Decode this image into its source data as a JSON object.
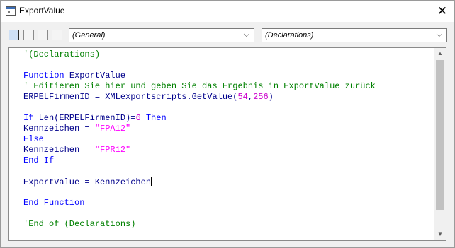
{
  "window": {
    "title": "ExportValue",
    "close_glyph": "✕"
  },
  "toolbar": {
    "view_buttons": [
      "full-module-view",
      "align-left",
      "align-right",
      "align-justify"
    ],
    "object_combo": {
      "value": "(General)"
    },
    "procedure_combo": {
      "value": "(Declarations)"
    },
    "dropdown_glyph": "⌵"
  },
  "editor": {
    "lines": [
      {
        "segments": [
          {
            "text": "'(Declarations)",
            "kind": "comment"
          }
        ]
      },
      {
        "segments": []
      },
      {
        "segments": [
          {
            "text": "Function",
            "kind": "keyword"
          },
          {
            "text": " ",
            "kind": "plain"
          },
          {
            "text": "ExportValue",
            "kind": "ident"
          }
        ]
      },
      {
        "segments": [
          {
            "text": "' Editieren Sie hier und geben Sie das Ergebnis in ExportValue zurück",
            "kind": "comment"
          }
        ]
      },
      {
        "segments": [
          {
            "text": "ERPELFirmenID = XMLexportscripts.GetValue(",
            "kind": "ident"
          },
          {
            "text": "54",
            "kind": "number"
          },
          {
            "text": ",",
            "kind": "ident"
          },
          {
            "text": "256",
            "kind": "number"
          },
          {
            "text": ")",
            "kind": "ident"
          }
        ]
      },
      {
        "segments": []
      },
      {
        "segments": [
          {
            "text": "If",
            "kind": "keyword"
          },
          {
            "text": " ",
            "kind": "plain"
          },
          {
            "text": "Len(ERPELFirmenID)=",
            "kind": "ident"
          },
          {
            "text": "6",
            "kind": "number"
          },
          {
            "text": " ",
            "kind": "plain"
          },
          {
            "text": "Then",
            "kind": "keyword"
          }
        ]
      },
      {
        "segments": [
          {
            "text": "Kennzeichen = ",
            "kind": "ident"
          },
          {
            "text": "\"FPA12\"",
            "kind": "string"
          }
        ]
      },
      {
        "segments": [
          {
            "text": "Else",
            "kind": "keyword"
          }
        ]
      },
      {
        "segments": [
          {
            "text": "Kennzeichen = ",
            "kind": "ident"
          },
          {
            "text": "\"FPR12\"",
            "kind": "string"
          }
        ]
      },
      {
        "segments": [
          {
            "text": "End If",
            "kind": "keyword"
          }
        ]
      },
      {
        "segments": []
      },
      {
        "segments": [
          {
            "text": "ExportValue = Kennzeichen",
            "kind": "ident"
          }
        ],
        "caret": true
      },
      {
        "segments": []
      },
      {
        "segments": [
          {
            "text": "End Function",
            "kind": "keyword"
          }
        ]
      },
      {
        "segments": []
      },
      {
        "segments": [
          {
            "text": "'End of (Declarations)",
            "kind": "comment"
          }
        ]
      }
    ]
  },
  "scrollbar": {
    "up_glyph": "▲",
    "down_glyph": "▼"
  },
  "colors": {
    "comment": "#008000",
    "keyword": "#0000ff",
    "ident": "#00008b",
    "number": "#cc00cc",
    "string": "#ff00ff",
    "plain": "#000000"
  }
}
